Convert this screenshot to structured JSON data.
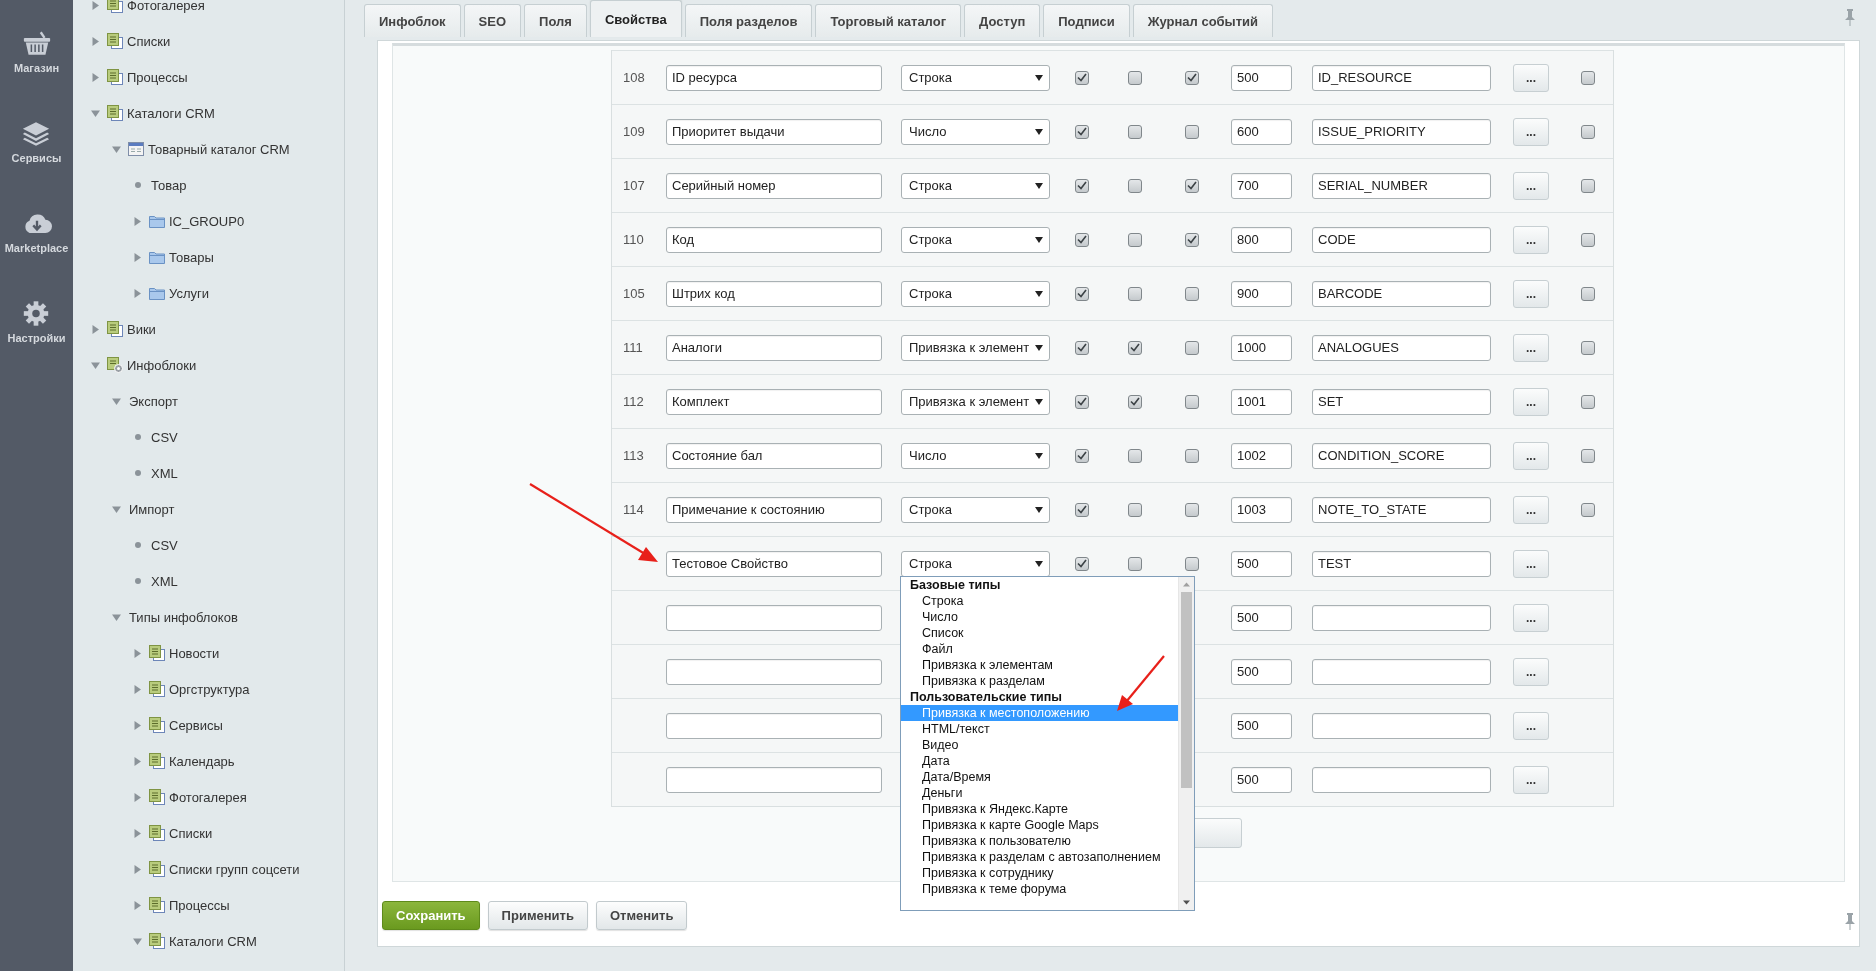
{
  "nav": [
    {
      "label": "Магазин",
      "kind": "basket"
    },
    {
      "label": "Сервисы",
      "kind": "layers"
    },
    {
      "label": "Marketplace",
      "kind": "cloud"
    },
    {
      "label": "Настройки",
      "kind": "gear"
    }
  ],
  "tree": [
    {
      "label": "Фотогалерея",
      "kind": "iblock",
      "expanded": false
    },
    {
      "label": "Списки",
      "kind": "iblock",
      "expanded": false
    },
    {
      "label": "Процессы",
      "kind": "iblock",
      "expanded": false
    },
    {
      "label": "Каталоги CRM",
      "kind": "iblock",
      "expanded": true,
      "children": [
        {
          "label": "Товарный каталог CRM",
          "kind": "catalog",
          "expanded": true,
          "children": [
            {
              "label": "Товар",
              "kind": "leaf"
            },
            {
              "label": "IC_GROUP0",
              "kind": "folder",
              "expanded": false
            },
            {
              "label": "Товары",
              "kind": "folder",
              "expanded": false
            },
            {
              "label": "Услуги",
              "kind": "folder",
              "expanded": false
            }
          ]
        }
      ]
    },
    {
      "label": "Вики",
      "kind": "iblock",
      "expanded": false
    },
    {
      "label": "Инфоблоки",
      "kind": "settings",
      "expanded": true,
      "children": [
        {
          "label": "Экспорт",
          "kind": "plain",
          "expanded": true,
          "children": [
            {
              "label": "CSV",
              "kind": "leaf"
            },
            {
              "label": "XML",
              "kind": "leaf"
            }
          ]
        },
        {
          "label": "Импорт",
          "kind": "plain",
          "expanded": true,
          "children": [
            {
              "label": "CSV",
              "kind": "leaf"
            },
            {
              "label": "XML",
              "kind": "leaf"
            }
          ]
        },
        {
          "label": "Типы инфоблоков",
          "kind": "plain",
          "expanded": true,
          "children": [
            {
              "label": "Новости",
              "kind": "iblock",
              "expanded": false
            },
            {
              "label": "Оргструктура",
              "kind": "iblock",
              "expanded": false
            },
            {
              "label": "Сервисы",
              "kind": "iblock",
              "expanded": false
            },
            {
              "label": "Календарь",
              "kind": "iblock",
              "expanded": false
            },
            {
              "label": "Фотогалерея",
              "kind": "iblock",
              "expanded": false
            },
            {
              "label": "Списки",
              "kind": "iblock",
              "expanded": false
            },
            {
              "label": "Списки групп соцсети",
              "kind": "iblock",
              "expanded": false
            },
            {
              "label": "Процессы",
              "kind": "iblock",
              "expanded": false
            },
            {
              "label": "Каталоги CRM",
              "kind": "iblock",
              "expanded": true
            }
          ]
        }
      ]
    }
  ],
  "tabs": [
    {
      "label": "Инфоблок",
      "selected": false
    },
    {
      "label": "SEO",
      "selected": false
    },
    {
      "label": "Поля",
      "selected": false
    },
    {
      "label": "Свойства",
      "selected": true
    },
    {
      "label": "Поля разделов",
      "selected": false
    },
    {
      "label": "Торговый каталог",
      "selected": false
    },
    {
      "label": "Доступ",
      "selected": false
    },
    {
      "label": "Подписи",
      "selected": false
    },
    {
      "label": "Журнал событий",
      "selected": false
    }
  ],
  "properties": {
    "rows": [
      {
        "id": "108",
        "name": "ID ресурса",
        "type": "Строка",
        "check_1": true,
        "check_2": false,
        "check_3": true,
        "sort": "500",
        "code": "ID_RESOURCE",
        "button": "...",
        "check_4": false
      },
      {
        "id": "109",
        "name": "Приоритет выдачи",
        "type": "Число",
        "check_1": true,
        "check_2": false,
        "check_3": false,
        "sort": "600",
        "code": "ISSUE_PRIORITY",
        "button": "...",
        "check_4": false
      },
      {
        "id": "107",
        "name": "Серийный номер",
        "type": "Строка",
        "check_1": true,
        "check_2": false,
        "check_3": true,
        "sort": "700",
        "code": "SERIAL_NUMBER",
        "button": "...",
        "check_4": false
      },
      {
        "id": "110",
        "name": "Код",
        "type": "Строка",
        "check_1": true,
        "check_2": false,
        "check_3": true,
        "sort": "800",
        "code": "CODE",
        "button": "...",
        "check_4": false
      },
      {
        "id": "105",
        "name": "Штрих код",
        "type": "Строка",
        "check_1": true,
        "check_2": false,
        "check_3": false,
        "sort": "900",
        "code": "BARCODE",
        "button": "...",
        "check_4": false
      },
      {
        "id": "111",
        "name": "Аналоги",
        "type": "Привязка к элемент",
        "check_1": true,
        "check_2": true,
        "check_3": false,
        "sort": "1000",
        "code": "ANALOGUES",
        "button": "...",
        "check_4": false
      },
      {
        "id": "112",
        "name": "Комплект",
        "type": "Привязка к элемент",
        "check_1": true,
        "check_2": true,
        "check_3": false,
        "sort": "1001",
        "code": "SET",
        "button": "...",
        "check_4": false
      },
      {
        "id": "113",
        "name": "Состояние бал",
        "type": "Число",
        "check_1": true,
        "check_2": false,
        "check_3": false,
        "sort": "1002",
        "code": "CONDITION_SCORE",
        "button": "...",
        "check_4": false
      },
      {
        "id": "114",
        "name": "Примечание к состоянию",
        "type": "Строка",
        "check_1": true,
        "check_2": false,
        "check_3": false,
        "sort": "1003",
        "code": "NOTE_TO_STATE",
        "button": "...",
        "check_4": false
      },
      {
        "name": "Тестовое Свойство",
        "type": "Строка",
        "check_1": true,
        "check_2": false,
        "check_3": false,
        "sort": "500",
        "code": "TEST",
        "button": "..."
      },
      {
        "sort": "500",
        "button": "..."
      },
      {
        "sort": "500",
        "button": "..."
      },
      {
        "sort": "500",
        "button": "..."
      },
      {
        "sort": "500",
        "button": "..."
      }
    ],
    "type_dropdown": {
      "groups": [
        {
          "label": "Базовые типы",
          "options": [
            {
              "label": "Строка",
              "selected": false
            },
            {
              "label": "Число",
              "selected": false
            },
            {
              "label": "Список",
              "selected": false
            },
            {
              "label": "Файл",
              "selected": false
            },
            {
              "label": "Привязка к элементам",
              "selected": false
            },
            {
              "label": "Привязка к разделам",
              "selected": false
            }
          ]
        },
        {
          "label": "Пользовательские типы",
          "options": [
            {
              "label": "Привязка к местоположению",
              "selected": true
            },
            {
              "label": "HTML/текст",
              "selected": false
            },
            {
              "label": "Видео",
              "selected": false
            },
            {
              "label": "Дата",
              "selected": false
            },
            {
              "label": "Дата/Время",
              "selected": false
            },
            {
              "label": "Деньги",
              "selected": false
            },
            {
              "label": "Привязка к Яндекс.Карте",
              "selected": false
            },
            {
              "label": "Привязка к карте Google Maps",
              "selected": false
            },
            {
              "label": "Привязка к пользователю",
              "selected": false
            },
            {
              "label": "Привязка к разделам с автозаполнением",
              "selected": false
            },
            {
              "label": "Привязка к сотруднику",
              "selected": false
            },
            {
              "label": "Привязка к теме форума",
              "selected": false
            }
          ]
        }
      ]
    }
  },
  "buttons": [
    {
      "label": "Сохранить",
      "kind": "primary"
    },
    {
      "label": "Применить",
      "kind": "secondary"
    },
    {
      "label": "Отменить",
      "kind": "secondary"
    }
  ]
}
